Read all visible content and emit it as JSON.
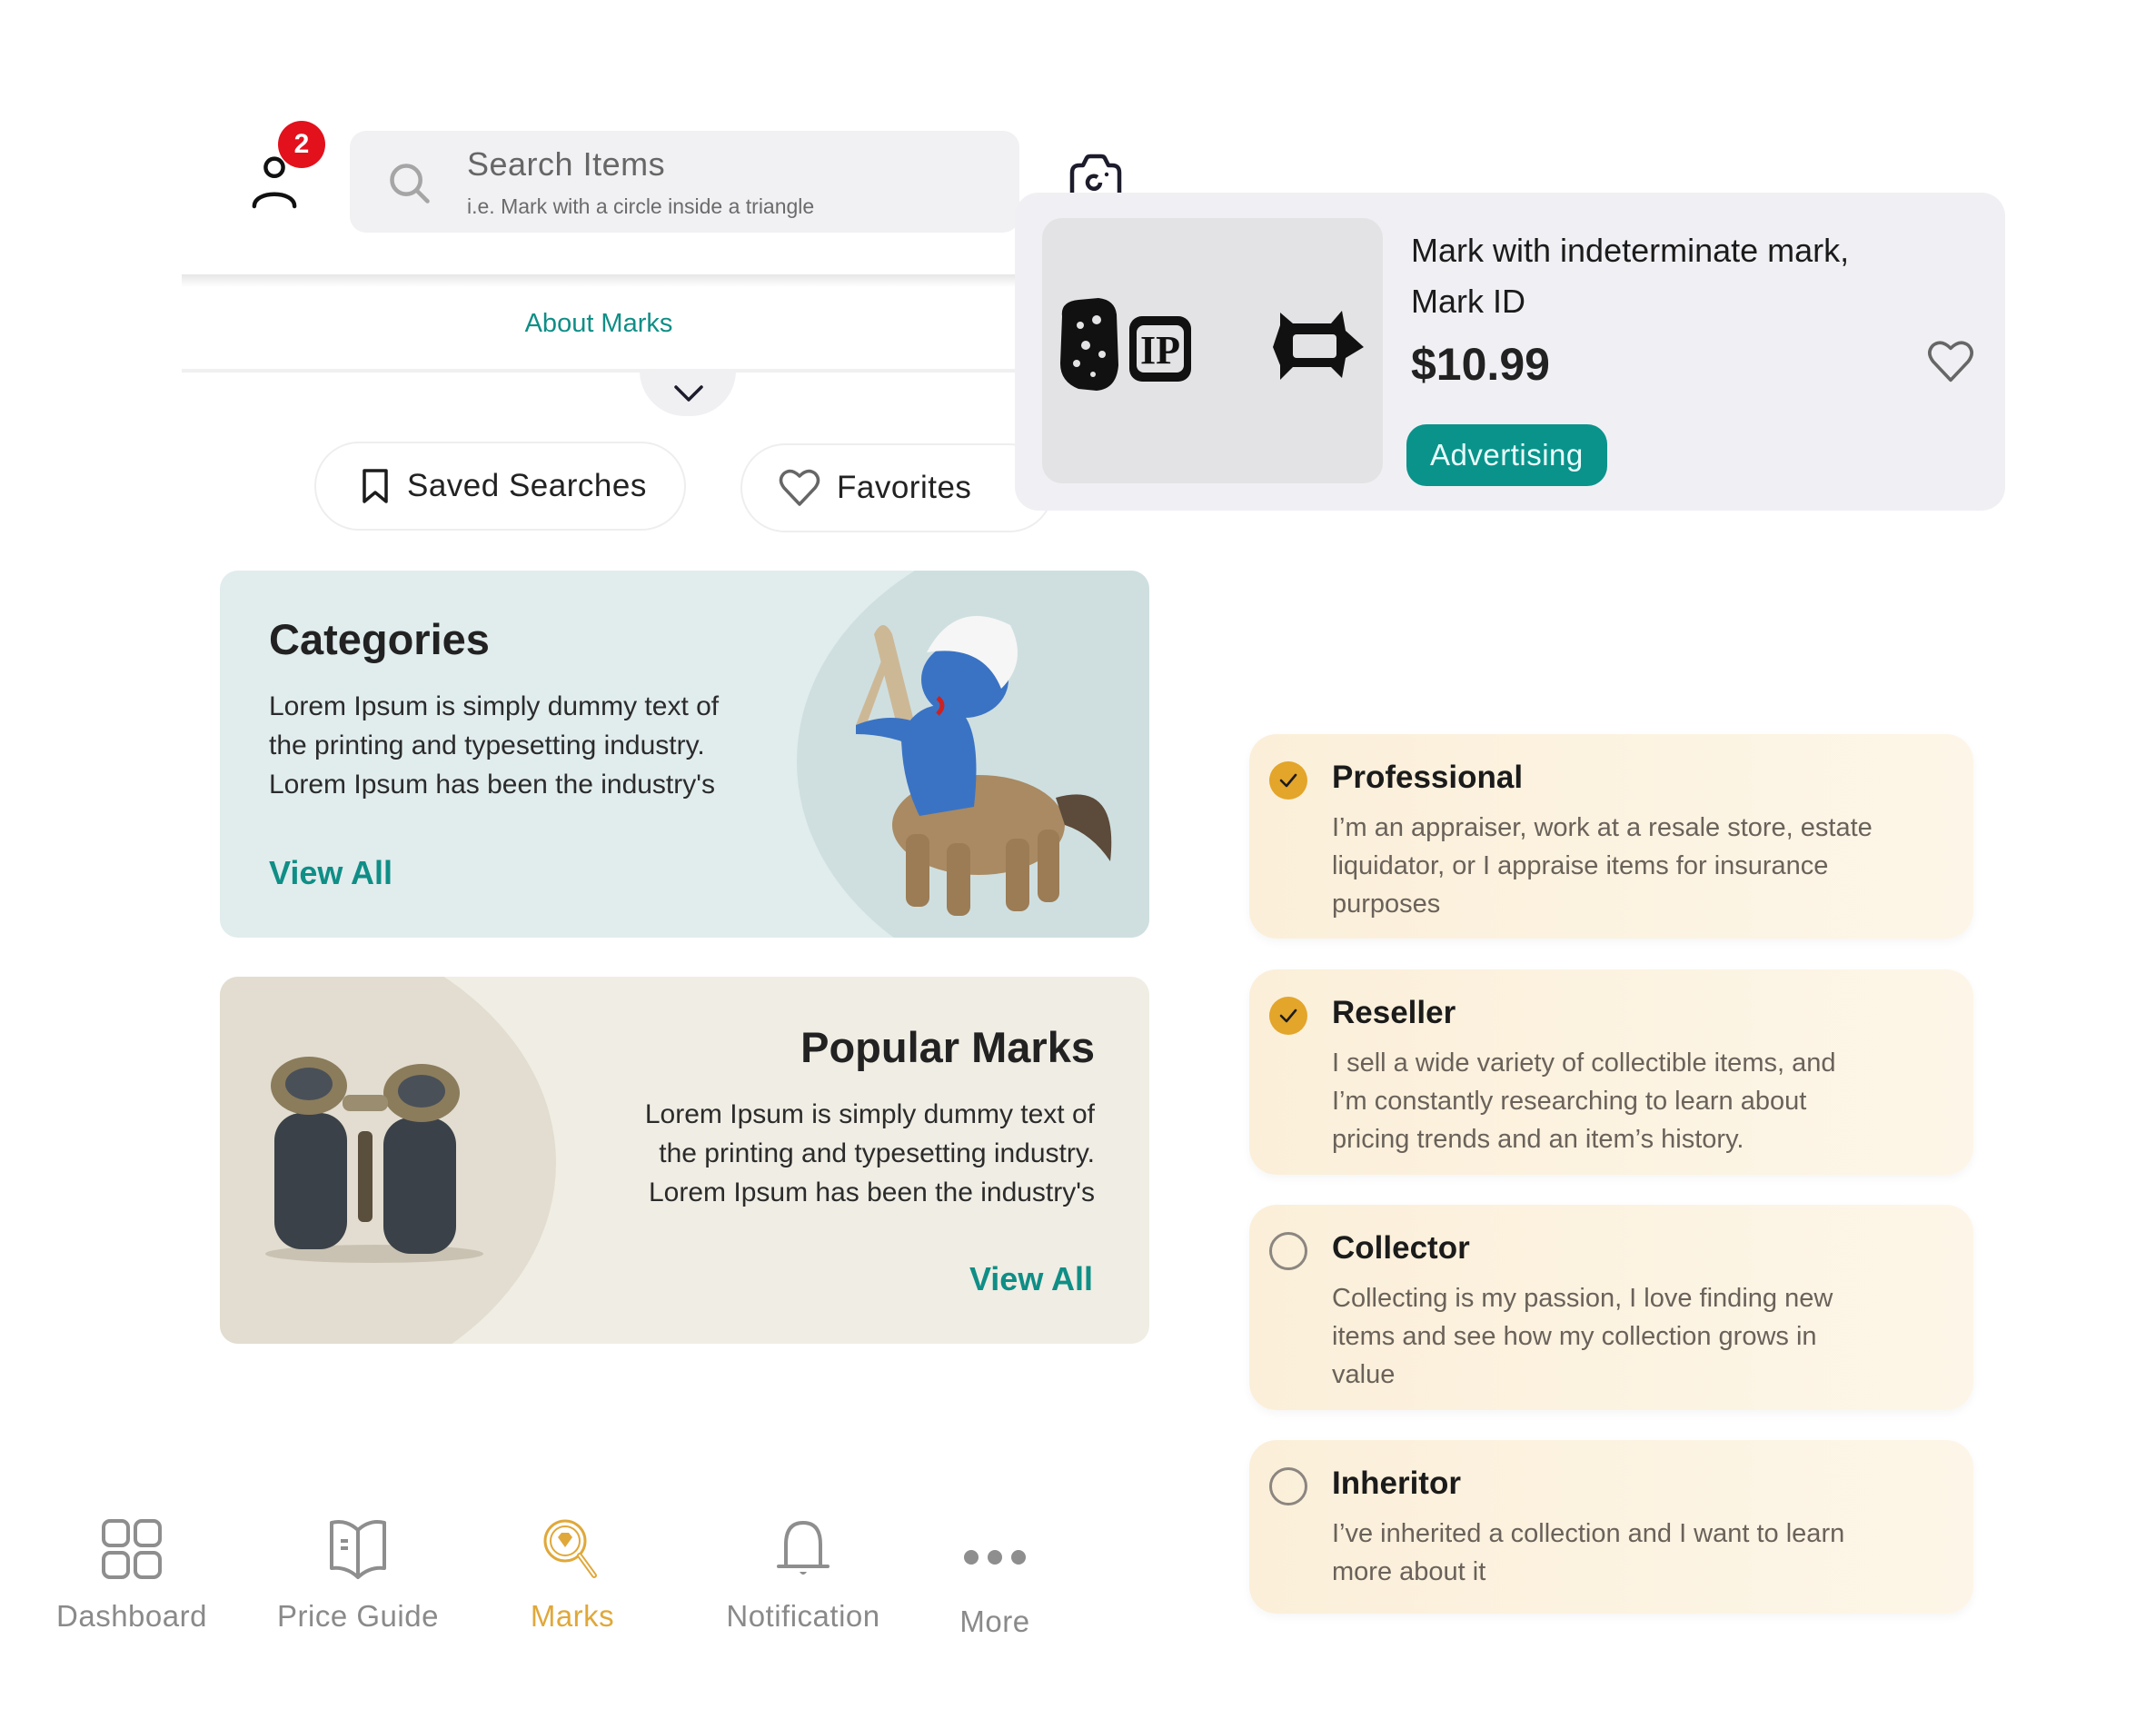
{
  "header": {
    "notification_count": "2",
    "search": {
      "title": "Search Items",
      "hint": "i.e. Mark with a circle inside a triangle"
    },
    "about_link": "About Marks"
  },
  "quick_actions": {
    "saved_searches": "Saved Searches",
    "favorites": "Favorites"
  },
  "product": {
    "title_line1": "Mark with indeterminate mark,",
    "title_line2": "Mark ID",
    "price": "$10.99",
    "tag": "Advertising",
    "mark_glyphs": [
      "ornate-mark",
      "IP",
      "bone-shaped-mark"
    ]
  },
  "cards": [
    {
      "title": "Categories",
      "body": "Lorem Ipsum is simply dummy text of the printing and typesetting industry. Lorem Ipsum has been the industry's",
      "lines": [
        "Lorem Ipsum is simply dummy text of",
        "the printing and typesetting industry.",
        "Lorem Ipsum has been the industry's"
      ],
      "link": "View All"
    },
    {
      "title": "Popular Marks",
      "lines": [
        "Lorem Ipsum is simply dummy text of",
        "the printing and typesetting industry.",
        "Lorem Ipsum has been the industry's"
      ],
      "link": "View All"
    }
  ],
  "roles": [
    {
      "title": "Professional",
      "checked": true,
      "lines": [
        "I’m an appraiser, work at a resale store, estate",
        "liquidator, or I appraise items for insurance",
        "purposes"
      ]
    },
    {
      "title": "Reseller",
      "checked": true,
      "lines": [
        "I sell a wide variety of collectible items, and",
        "I’m constantly researching to learn about",
        "pricing trends and an item’s history."
      ]
    },
    {
      "title": "Collector",
      "checked": false,
      "lines": [
        "Collecting is my passion, I love finding new",
        "items and see how my collection grows in",
        "value"
      ]
    },
    {
      "title": "Inheritor",
      "checked": false,
      "lines": [
        "I’ve inherited a collection and I want to learn",
        "more about it"
      ]
    }
  ],
  "nav": [
    {
      "label": "Dashboard",
      "icon": "grid-icon",
      "active": false
    },
    {
      "label": "Price Guide",
      "icon": "book-icon",
      "active": false
    },
    {
      "label": "Marks",
      "icon": "magnifier-diamond-icon",
      "active": true
    },
    {
      "label": "Notification",
      "icon": "bell-icon",
      "active": false
    },
    {
      "label": "More",
      "icon": "more-dots-icon",
      "active": false
    }
  ],
  "colors": {
    "accent_teal": "#0f8e86",
    "button_teal": "#0a938b",
    "active_gold": "#e0a83a",
    "check_gold": "#e3a52a",
    "badge_red": "#e2111c"
  }
}
